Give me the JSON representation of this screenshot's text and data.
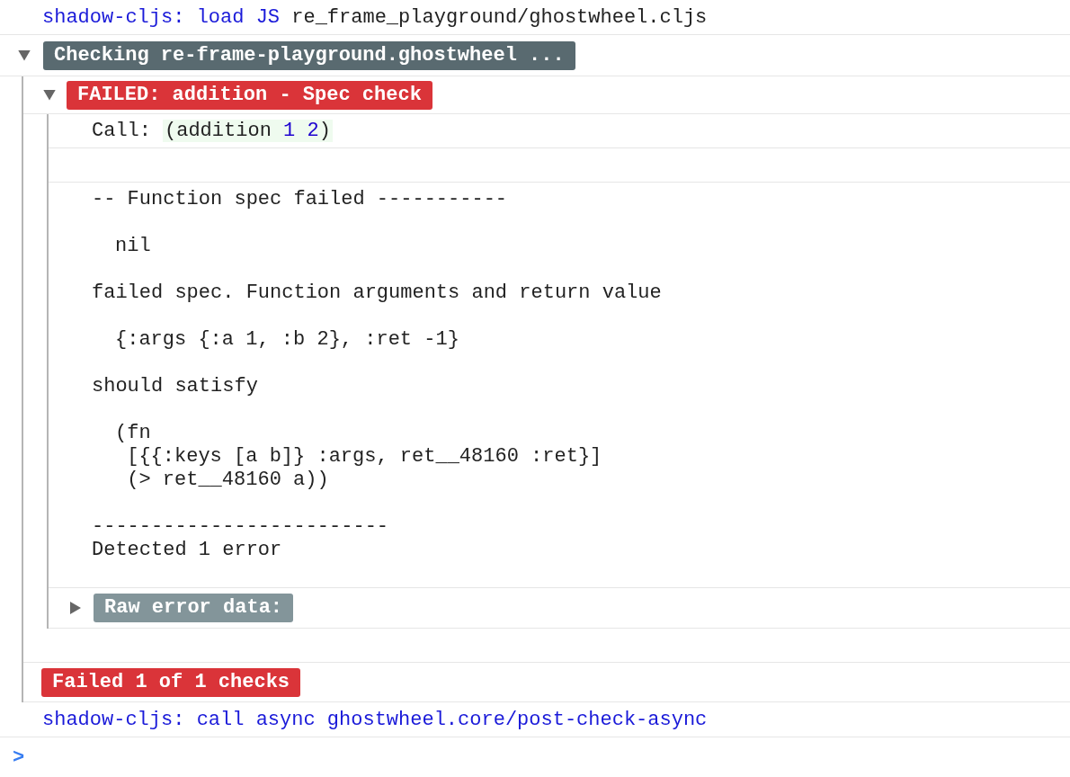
{
  "load_message": {
    "prefix": "shadow-cljs: load JS",
    "path": "re_frame_playground/ghostwheel.cljs"
  },
  "group": {
    "expanded": true,
    "label": "Checking re-frame-playground.ghostwheel ...",
    "failure": {
      "expanded": true,
      "label": "FAILED: addition - Spec check",
      "call": {
        "label": "Call:",
        "form": [
          {
            "text": "(addition ",
            "kind": "symbol"
          },
          {
            "text": "1 2",
            "kind": "number"
          },
          {
            "text": ")",
            "kind": "symbol"
          }
        ]
      },
      "report": [
        {
          "indented": false,
          "text": "-- Function spec failed -----------"
        },
        {
          "indented": true,
          "text": "nil"
        },
        {
          "indented": false,
          "text": "failed spec. Function arguments and return value"
        },
        {
          "indented": true,
          "text": "{:args {:a 1, :b 2}, :ret -1}"
        },
        {
          "indented": false,
          "text": "should satisfy"
        },
        {
          "indented": true,
          "text": "(fn\n [{{:keys [a b]} :args, ret__48160 :ret}]\n (> ret__48160 a))"
        },
        {
          "indented": false,
          "text": "-------------------------\nDetected 1 error"
        }
      ],
      "raw": {
        "expanded": false,
        "label": "Raw error data:"
      }
    },
    "summary": "Failed 1 of 1 checks"
  },
  "call_message": "shadow-cljs: call async ghostwheel.core/post-check-async",
  "prompt": ">"
}
